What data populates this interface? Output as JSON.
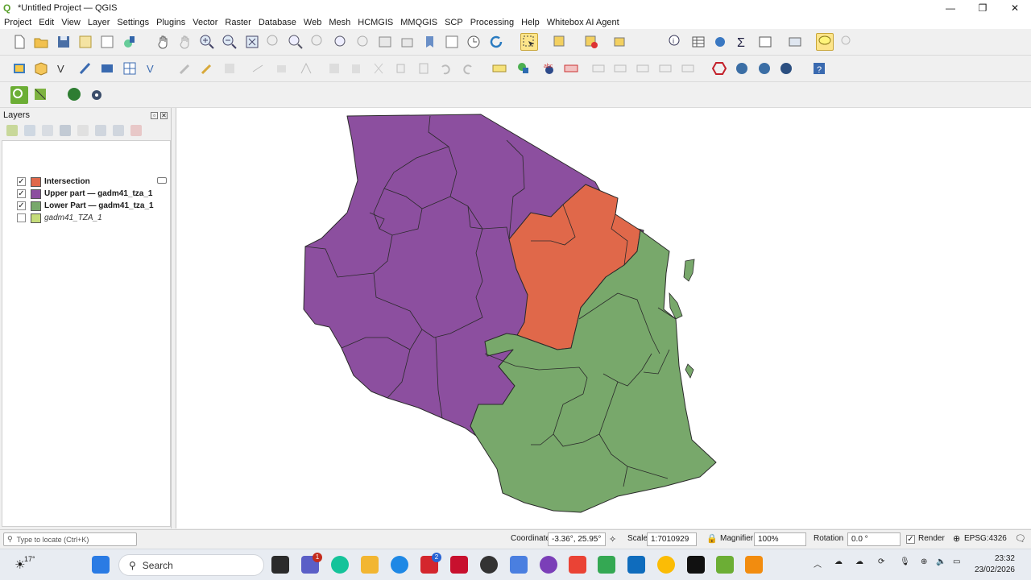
{
  "window": {
    "title": "*Untitled Project — QGIS"
  },
  "menu": [
    "Project",
    "Edit",
    "View",
    "Layer",
    "Settings",
    "Plugins",
    "Vector",
    "Raster",
    "Database",
    "Web",
    "Mesh",
    "HCMGIS",
    "MMQGIS",
    "SCP",
    "Processing",
    "Help",
    "Whitebox AI Agent"
  ],
  "layers_panel": {
    "title": "Layers",
    "items": [
      {
        "name": "Intersection",
        "checked": true,
        "color": "#e0684a"
      },
      {
        "name": "Upper part — gadm41_tza_1",
        "checked": true,
        "color": "#8c4f9f"
      },
      {
        "name": "Lower Part — gadm41_tza_1",
        "checked": true,
        "color": "#78a86b"
      },
      {
        "name": "gadm41_TZA_1",
        "checked": false,
        "color": "#c5dc7a"
      }
    ]
  },
  "statusbar": {
    "locate_placeholder": "Type to locate (Ctrl+K)",
    "coordinate_label": "Coordinate",
    "coordinate_value": "-3.36°, 25.95°",
    "scale_label": "Scale",
    "scale_value": "1:7010929",
    "magnifier_label": "Magnifier",
    "magnifier_value": "100%",
    "rotation_label": "Rotation",
    "rotation_value": "0.0 °",
    "render_label": "Render",
    "crs": "EPSG:4326"
  },
  "taskbar": {
    "weather": "17°",
    "search_label": "Search",
    "time": "23:32",
    "date": "23/02/2026",
    "teams_badge": "1",
    "todo_badge": "2"
  },
  "colors": {
    "intersection": "#e0684a",
    "upper": "#8c4f9f",
    "lower": "#78a86b"
  }
}
